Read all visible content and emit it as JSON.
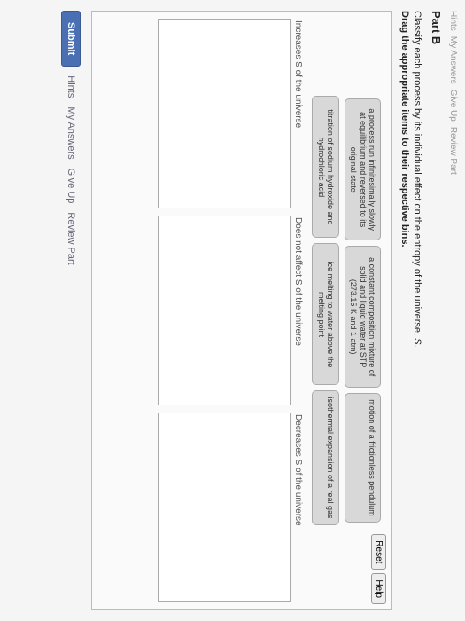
{
  "nav": {
    "hints_top": "Hints",
    "my_answers_top": "My Answers",
    "give_up_top": "Give Up",
    "review_top": "Review Part"
  },
  "part_title": "Part B",
  "instruction_line1_a": "Classify each process by its individual effect on the entropy of the universe, ",
  "instruction_line1_s": "S",
  "instruction_line1_b": ".",
  "instruction_line2": "Drag the appropriate items to their respective bins.",
  "buttons": {
    "reset": "Reset",
    "help": "Help",
    "submit": "Submit"
  },
  "items": {
    "row1": [
      "a process run infinitesimally slowly at equilibrium and reversed to its original state",
      "a constant composition mixture of solid and liquid water at STP (273.15 K and 1 atm)",
      "motion of a frictionless pendulum"
    ],
    "row2": [
      "titration of sodium hydroxide and hydrochloric acid",
      "ice melting to water above the melting point",
      "isothermal expansion of a real gas"
    ]
  },
  "bins": [
    "Increases S of the universe",
    "Does not affect S of the universe",
    "Decreases S of the universe"
  ],
  "links": {
    "hints": "Hints",
    "my_answers": "My Answers",
    "give_up": "Give Up",
    "review": "Review Part"
  }
}
